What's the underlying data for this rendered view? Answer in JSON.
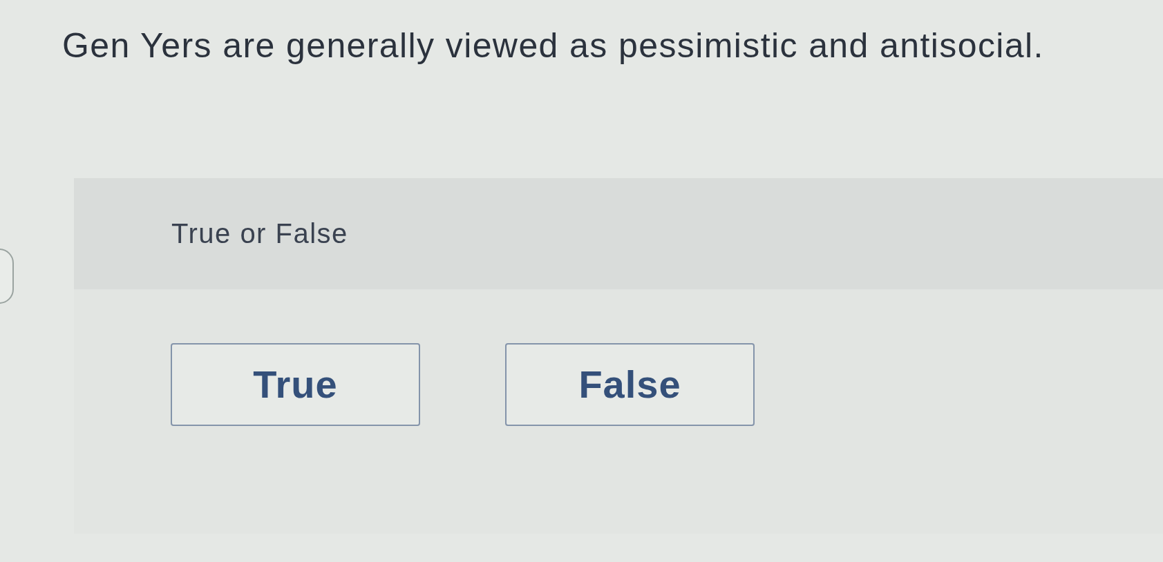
{
  "question": {
    "text": "Gen Yers are generally viewed as pessimistic and antisocial."
  },
  "prompt": {
    "text": "True or False"
  },
  "options": [
    {
      "label": "True",
      "selected": false
    },
    {
      "label": "False",
      "selected": false
    }
  ]
}
